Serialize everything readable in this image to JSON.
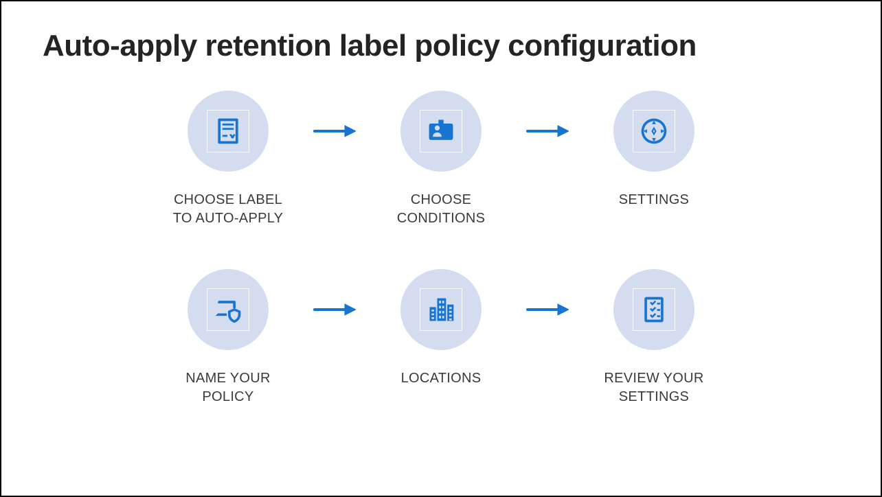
{
  "title": "Auto-apply retention label policy configuration",
  "accent_color": "#1874d1",
  "badge_bg": "#d3ddef",
  "steps": [
    {
      "label": "CHOOSE LABEL\nTO AUTO-APPLY",
      "icon": "document-check-icon"
    },
    {
      "label": "CHOOSE\nCONDITIONS",
      "icon": "id-badge-icon"
    },
    {
      "label": "SETTINGS",
      "icon": "compass-icon"
    },
    {
      "label": "NAME YOUR\nPOLICY",
      "icon": "device-shield-icon"
    },
    {
      "label": "LOCATIONS",
      "icon": "buildings-icon"
    },
    {
      "label": "REVIEW YOUR\nSETTINGS",
      "icon": "checklist-icon"
    }
  ]
}
